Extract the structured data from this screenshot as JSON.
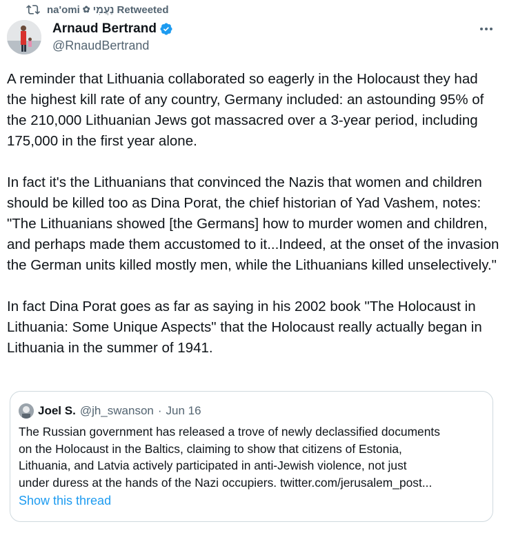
{
  "retweet": {
    "icon": "retweet-icon",
    "user": "na'omi",
    "emoji": "flower-emoji",
    "hebrew_name": "נַעֲמִי",
    "label": "Retweeted"
  },
  "author": {
    "display_name": "Arnaud Bertrand",
    "handle": "@RnaudBertrand",
    "verified": true,
    "verified_color": "#1d9bf0"
  },
  "tweet": {
    "paragraphs": [
      "A reminder that Lithuania collaborated so eagerly in the Holocaust they had the highest kill rate of any country, Germany included: an astounding 95% of the 210,000 Lithuanian Jews got massacred over a 3-year period, including 175,000 in the first year alone.",
      "In fact it's the Lithuanians that convinced the Nazis that women and children should be killed too as Dina Porat, the chief historian of Yad Vashem, notes: \"The Lithuanians showed [the Germans] how to murder women and children, and perhaps made them accustomed to it...Indeed, at the onset of the invasion the German units killed mostly men, while the Lithuanians killed unselectively.\"",
      "In fact Dina Porat goes as far as saying in his 2002 book \"The Holocaust in Lithuania: Some Unique Aspects\" that the Holocaust really actually began in Lithuania in the summer of 1941."
    ]
  },
  "quote": {
    "display_name": "Joel S.",
    "handle": "@jh_swanson",
    "separator": "·",
    "date": "Jun 16",
    "lines": [
      "The Russian government has released a trove of newly declassified documents",
      "on the Holocaust in the Baltics, claiming to show that citizens of Estonia,",
      "Lithuania, and Latvia actively participated in anti-Jewish violence, not just",
      "under duress at the hands of the Nazi occupiers. twitter.com/jerusalem_post..."
    ],
    "show_thread": "Show this thread"
  },
  "colors": {
    "text": "#0f1419",
    "secondary": "#536471",
    "link": "#1d9bf0",
    "border": "#cfd9de"
  }
}
